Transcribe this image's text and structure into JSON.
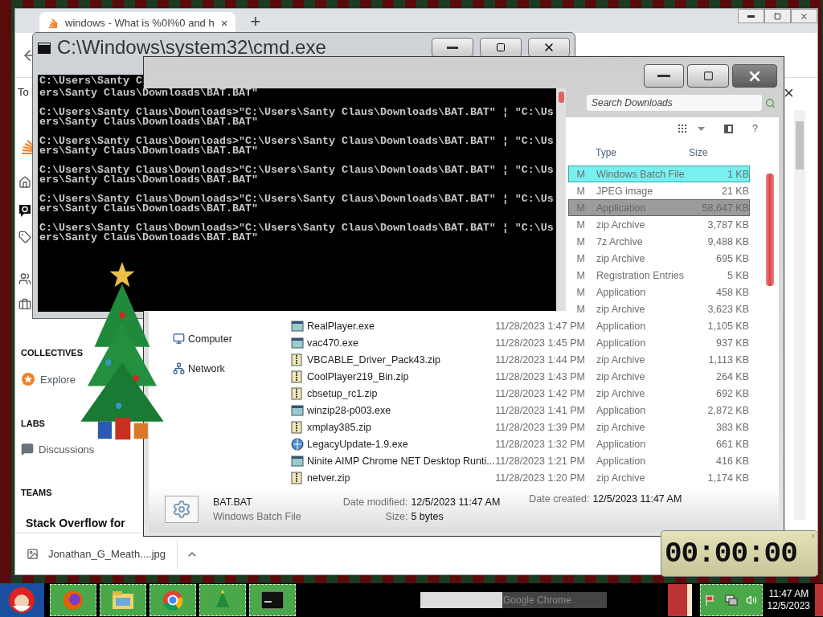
{
  "browser": {
    "tab_title": "windows - What is %0I%0 and h",
    "tab_close": "×",
    "new_tab": "+",
    "cut_text": "To",
    "sections": [
      {
        "heading": "COLLECTIVES",
        "items": [
          {
            "label": "Explore",
            "kind": "collective"
          }
        ]
      },
      {
        "heading": "LABS",
        "items": [
          {
            "label": "Discussions",
            "kind": "discussion"
          }
        ]
      },
      {
        "heading": "TEAMS",
        "items": [
          {
            "label": "Stack Overflow for",
            "kind": "team"
          }
        ]
      }
    ],
    "banner_close": "×",
    "download": {
      "filename": "Jonathan_G_Meath....jpg"
    }
  },
  "cmd": {
    "title": "C:\\Windows\\system32\\cmd.exe",
    "first_line": "C:\\Users\\Santy C",
    "blocks": [
      {
        "lines": [
          "ers\\Santy Claus\\Downloads\\BAT.BAT\""
        ]
      },
      {
        "lines": [
          "C:\\Users\\Santy Claus\\Downloads>\"C:\\Users\\Santy Claus\\Downloads\\BAT.BAT\" ¦ \"C:\\Us",
          "ers\\Santy Claus\\Downloads\\BAT.BAT\""
        ]
      },
      {
        "lines": [
          "C:\\Users\\Santy Claus\\Downloads>\"C:\\Users\\Santy Claus\\Downloads\\BAT.BAT\" ¦ \"C:\\Us",
          "ers\\Santy Claus\\Downloads\\BAT.BAT\""
        ]
      },
      {
        "lines": [
          "C:\\Users\\Santy Claus\\Downloads>\"C:\\Users\\Santy Claus\\Downloads\\BAT.BAT\" ¦ \"C:\\Us",
          "ers\\Santy Claus\\Downloads\\BAT.BAT\""
        ]
      },
      {
        "lines": [
          "C:\\Users\\Santy Claus\\Downloads>\"C:\\Users\\Santy Claus\\Downloads\\BAT.BAT\" ¦ \"C:\\Us",
          "ers\\Santy Claus\\Downloads\\BAT.BAT\""
        ]
      },
      {
        "lines": [
          "C:\\Users\\Santy Claus\\Downloads>\"C:\\Users\\Santy Claus\\Downloads\\BAT.BAT\" ¦ \"C:\\Us",
          "ers\\Santy Claus\\Downloads\\BAT.BAT\""
        ]
      }
    ]
  },
  "explorer": {
    "search": {
      "placeholder": "Search Downloads"
    },
    "help": "?",
    "nav": [
      {
        "label": "Computer",
        "kind": "computer"
      },
      {
        "label": "Network",
        "kind": "network"
      }
    ],
    "columns": [
      "Type",
      "Size"
    ],
    "rows": [
      {
        "date": "M",
        "type": "Windows Batch File",
        "size": "1 KB",
        "selected": true,
        "hovered": false
      },
      {
        "date": "M",
        "type": "JPEG image",
        "size": "21 KB",
        "selected": false,
        "hovered": false
      },
      {
        "date": "M",
        "type": "Application",
        "size": "58,647 KB",
        "selected": false,
        "hovered": true
      },
      {
        "date": "M",
        "type": "zip Archive",
        "size": "3,787 KB",
        "selected": false,
        "hovered": false
      },
      {
        "date": "M",
        "type": "7z Archive",
        "size": "9,488 KB",
        "selected": false,
        "hovered": false
      },
      {
        "date": "M",
        "type": "zip Archive",
        "size": "695 KB",
        "selected": false,
        "hovered": false
      },
      {
        "date": "M",
        "type": "Registration Entries",
        "size": "5 KB",
        "selected": false,
        "hovered": false
      },
      {
        "date": "M",
        "type": "Application",
        "size": "458 KB",
        "selected": false,
        "hovered": false
      },
      {
        "date": "M",
        "type": "zip Archive",
        "size": "3,623 KB",
        "selected": false,
        "hovered": false
      },
      {
        "name": "RealPlayer.exe",
        "kind": "app",
        "date": "11/28/2023 1:47 PM",
        "type": "Application",
        "size": "1,105 KB",
        "selected": false,
        "hovered": false
      },
      {
        "name": "vac470.exe",
        "kind": "app",
        "date": "11/28/2023 1:45 PM",
        "type": "Application",
        "size": "937 KB",
        "selected": false,
        "hovered": false
      },
      {
        "name": "VBCABLE_Driver_Pack43.zip",
        "kind": "zip",
        "date": "11/28/2023 1:44 PM",
        "type": "zip Archive",
        "size": "1,113 KB",
        "selected": false,
        "hovered": false
      },
      {
        "name": "CoolPlayer219_Bin.zip",
        "kind": "zip",
        "date": "11/28/2023 1:43 PM",
        "type": "zip Archive",
        "size": "264 KB",
        "selected": false,
        "hovered": false
      },
      {
        "name": "cbsetup_rc1.zip",
        "kind": "zip",
        "date": "11/28/2023 1:42 PM",
        "type": "zip Archive",
        "size": "692 KB",
        "selected": false,
        "hovered": false
      },
      {
        "name": "winzip28-p003.exe",
        "kind": "app",
        "date": "11/28/2023 1:41 PM",
        "type": "Application",
        "size": "2,872 KB",
        "selected": false,
        "hovered": false
      },
      {
        "name": "xmplay385.zip",
        "kind": "zip",
        "date": "11/28/2023 1:39 PM",
        "type": "zip Archive",
        "size": "383 KB",
        "selected": false,
        "hovered": false
      },
      {
        "name": "LegacyUpdate-1.9.exe",
        "kind": "globe",
        "date": "11/28/2023 1:32 PM",
        "type": "Application",
        "size": "661 KB",
        "selected": false,
        "hovered": false
      },
      {
        "name": "Ninite AIMP Chrome NET Desktop Runti...",
        "kind": "app",
        "date": "11/28/2023 1:21 PM",
        "type": "Application",
        "size": "416 KB",
        "selected": false,
        "hovered": false
      },
      {
        "name": "netver.zip",
        "kind": "zip",
        "date": "11/28/2023 1:20 PM",
        "type": "zip Archive",
        "size": "1,174 KB",
        "selected": false,
        "hovered": false
      }
    ],
    "details": {
      "name": "BAT.BAT",
      "type": "Windows Batch File",
      "fields": [
        {
          "label": "Date modified:",
          "value": "12/5/2023 11:47 AM"
        },
        {
          "label": "Size:",
          "value": "5 bytes"
        }
      ],
      "created": {
        "label": "Date created:",
        "value": "12/5/2023 11:47 AM"
      }
    }
  },
  "timer": {
    "display": "00:00:00",
    "close": "×"
  },
  "taskbar": {
    "label": "Google Chrome",
    "time": "11:47 AM",
    "date": "12/5/2023"
  }
}
